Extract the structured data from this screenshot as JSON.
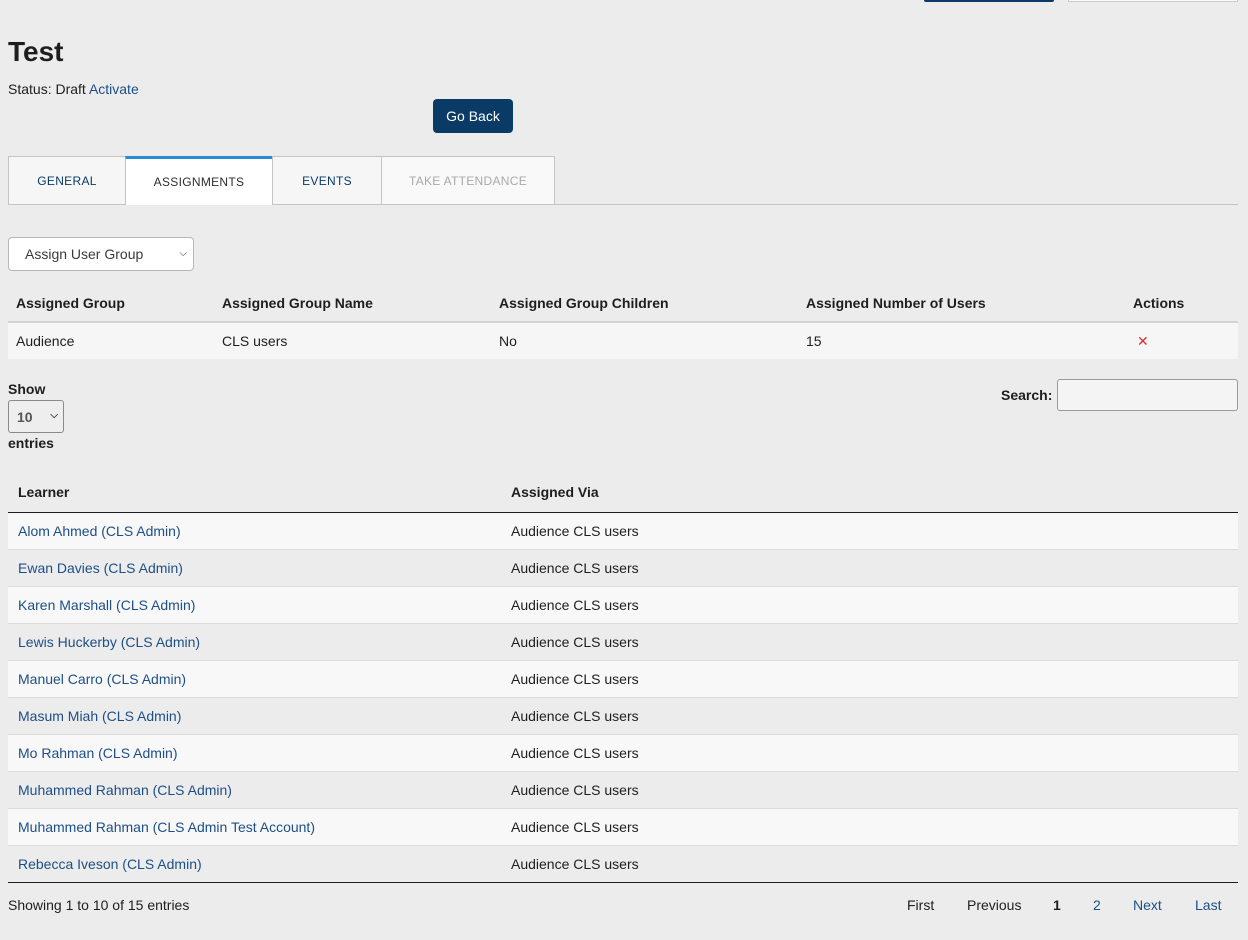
{
  "page": {
    "title": "Test",
    "status_label": "Status: Draft",
    "activate_link": "Activate",
    "go_back": "Go Back"
  },
  "tabs": [
    {
      "label": "GENERAL",
      "state": "normal"
    },
    {
      "label": "ASSIGNMENTS",
      "state": "active"
    },
    {
      "label": "EVENTS",
      "state": "normal"
    },
    {
      "label": "TAKE ATTENDANCE",
      "state": "disabled"
    }
  ],
  "assign_select": {
    "selected": "Assign User Group"
  },
  "groups_table": {
    "headers": [
      "Assigned Group",
      "Assigned Group Name",
      "Assigned Group Children",
      "Assigned Number of Users",
      "Actions"
    ],
    "rows": [
      {
        "group": "Audience",
        "name": "CLS users",
        "children": "No",
        "users": "15",
        "action_icon": "delete-x-icon"
      }
    ]
  },
  "length_control": {
    "show_label": "Show",
    "value": "10",
    "entries_label": "entries"
  },
  "search": {
    "label": "Search:",
    "value": ""
  },
  "learners_table": {
    "headers": [
      "Learner",
      "Assigned Via"
    ],
    "rows": [
      {
        "learner": "Alom Ahmed (CLS Admin)",
        "via": "Audience CLS users"
      },
      {
        "learner": "Ewan Davies (CLS Admin)",
        "via": "Audience CLS users"
      },
      {
        "learner": "Karen Marshall (CLS Admin)",
        "via": "Audience CLS users"
      },
      {
        "learner": "Lewis Huckerby (CLS Admin)",
        "via": "Audience CLS users"
      },
      {
        "learner": "Manuel Carro (CLS Admin)",
        "via": "Audience CLS users"
      },
      {
        "learner": "Masum Miah (CLS Admin)",
        "via": "Audience CLS users"
      },
      {
        "learner": "Mo Rahman (CLS Admin)",
        "via": "Audience CLS users"
      },
      {
        "learner": "Muhammed Rahman (CLS Admin)",
        "via": "Audience CLS users"
      },
      {
        "learner": "Muhammed Rahman (CLS Admin Test Account)",
        "via": "Audience CLS users"
      },
      {
        "learner": "Rebecca Iveson (CLS Admin)",
        "via": "Audience CLS users"
      }
    ]
  },
  "info_text": "Showing 1 to 10 of 15 entries",
  "pagination": {
    "first": "First",
    "previous": "Previous",
    "pages": [
      "1",
      "2"
    ],
    "current": "1",
    "next": "Next",
    "last": "Last"
  },
  "colors": {
    "primary": "#0a3a66",
    "link": "#1d4f86",
    "tab_accent": "#2a8ad4",
    "delete": "#d23232"
  }
}
